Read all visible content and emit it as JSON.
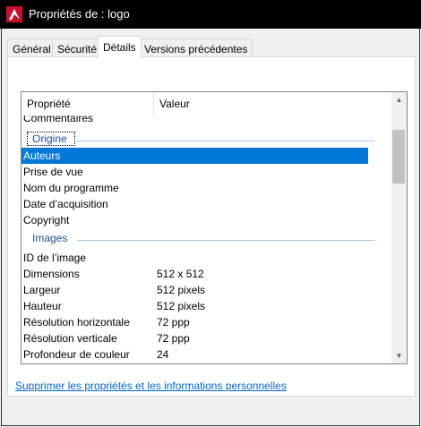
{
  "window": {
    "title": "Propriétés de : logo"
  },
  "tabs": [
    {
      "label": "Général"
    },
    {
      "label": "Sécurité"
    },
    {
      "label": "Détails"
    },
    {
      "label": "Versions précédentes"
    }
  ],
  "active_tab": "Détails",
  "list": {
    "headers": {
      "property": "Propriété",
      "value": "Valeur"
    },
    "clipped_top_row": "Commentaires",
    "groups": {
      "origin": "Origine",
      "images": "Images"
    },
    "origin_rows": [
      {
        "k": "Auteurs",
        "v": ""
      },
      {
        "k": "Prise de vue",
        "v": ""
      },
      {
        "k": "Nom du programme",
        "v": ""
      },
      {
        "k": "Date d’acquisition",
        "v": ""
      },
      {
        "k": "Copyright",
        "v": ""
      }
    ],
    "image_rows": [
      {
        "k": "ID de l’image",
        "v": ""
      },
      {
        "k": "Dimensions",
        "v": "512 x 512"
      },
      {
        "k": "Largeur",
        "v": "512 pixels"
      },
      {
        "k": "Hauteur",
        "v": "512 pixels"
      },
      {
        "k": "Résolution horizontale",
        "v": "72 ppp"
      },
      {
        "k": "Résolution verticale",
        "v": "72 ppp"
      },
      {
        "k": "Profondeur de couleur",
        "v": "24"
      }
    ],
    "selected_row": "Auteurs"
  },
  "link_text": "Supprimer les propriétés et les informations personnelles",
  "colors": {
    "selection": "#0078d7",
    "group_label": "#1e4e8c",
    "link": "#0066cc",
    "titlebar": "#000000"
  }
}
